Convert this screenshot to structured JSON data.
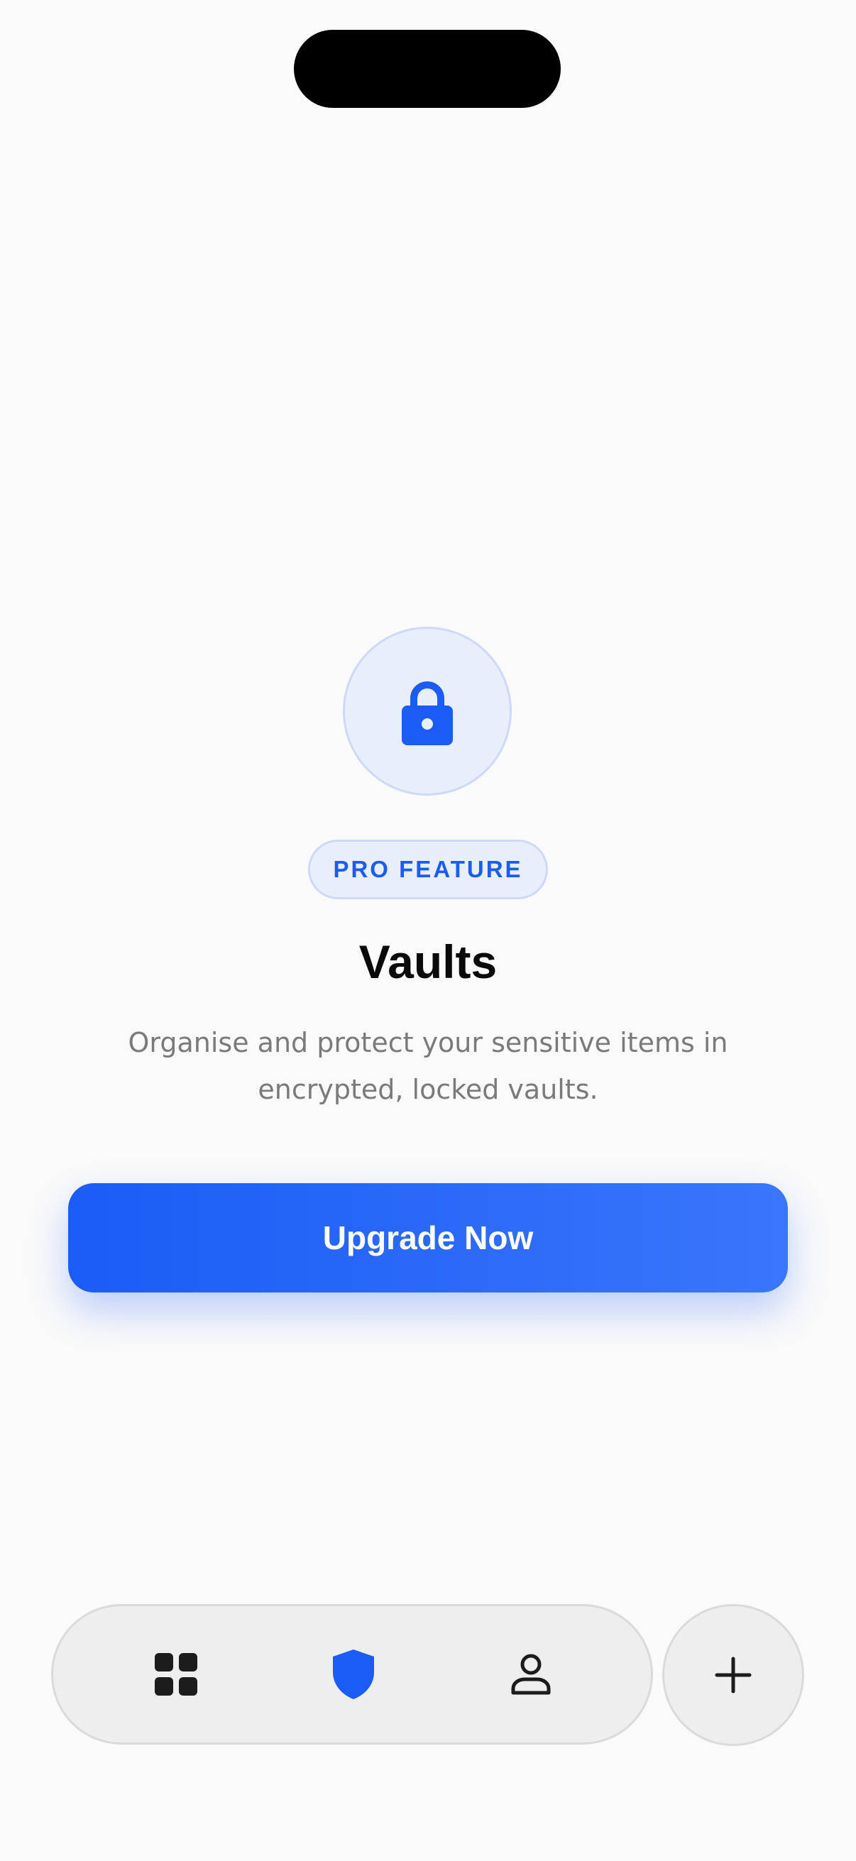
{
  "badge": {
    "label": "PRO FEATURE"
  },
  "main": {
    "title": "Vaults",
    "description": "Organise and protect your sensitive items in encrypted, locked vaults.",
    "cta_label": "Upgrade Now"
  },
  "icons": {
    "hero": "lock-icon",
    "tabs": [
      "grid-icon",
      "shield-icon",
      "person-icon"
    ],
    "add": "plus-icon"
  },
  "tab_bar": {
    "active_tab": "vaults"
  },
  "colors": {
    "accent": "#1a5cf5",
    "accent_light": "#3a76fb",
    "badge_background": "#e9eefb",
    "icon_dark": "#1c1c1c",
    "background": "#fafafa"
  }
}
